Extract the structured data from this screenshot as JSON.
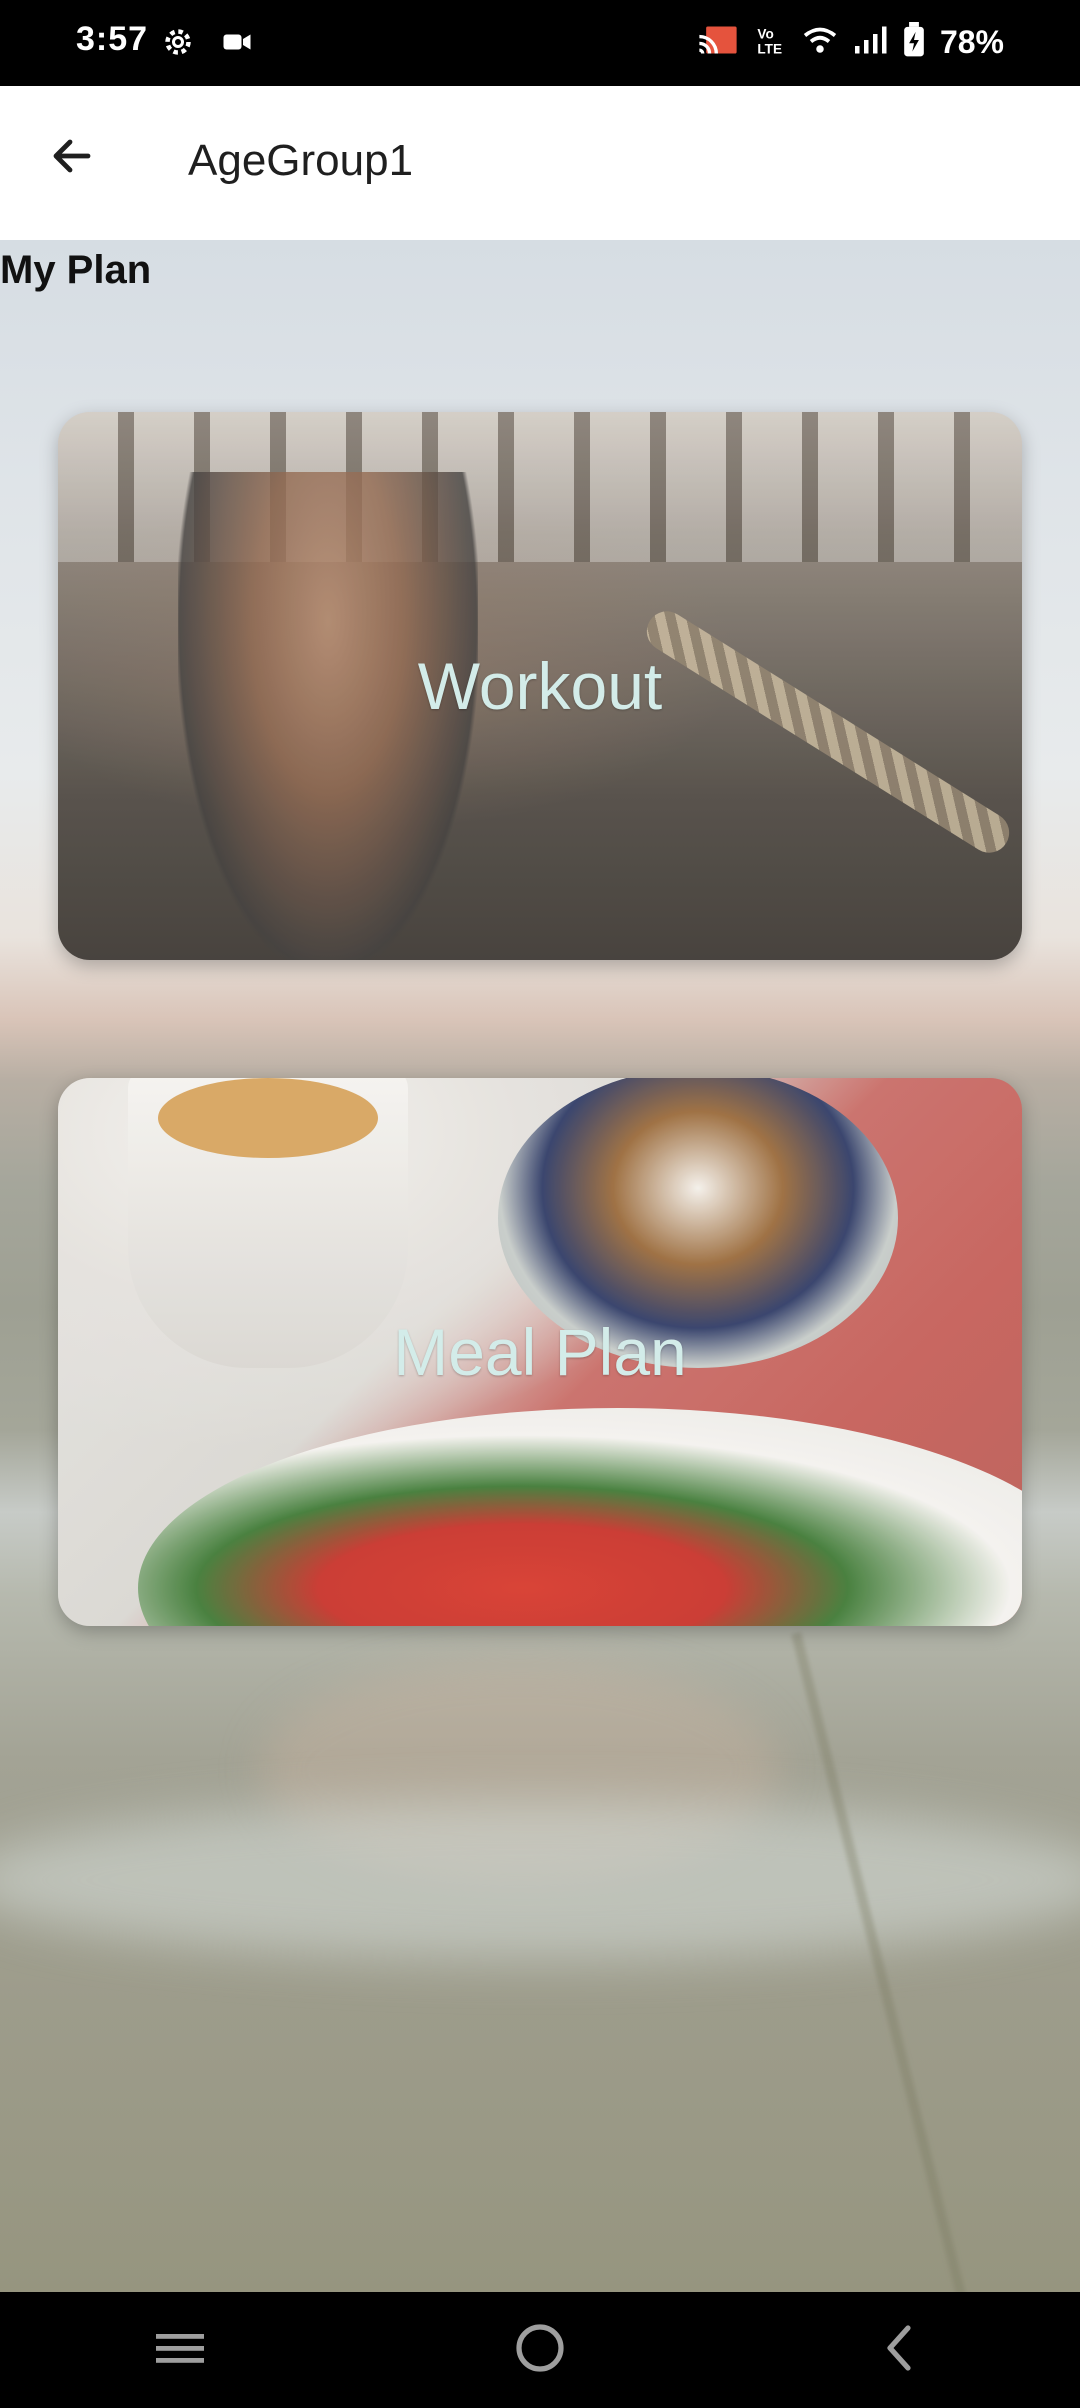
{
  "status_bar": {
    "time": "3:57",
    "battery_percent": "78%",
    "icons": [
      "settings-icon",
      "video-icon",
      "cast-icon",
      "volte-icon",
      "wifi-icon",
      "signal-icon",
      "battery-icon"
    ]
  },
  "app_bar": {
    "title": "AgeGroup1",
    "back_icon": "arrow-left-icon"
  },
  "content": {
    "heading": "My Plan",
    "cards": [
      {
        "label": "Workout",
        "image": "workout-battle-ropes-photo"
      },
      {
        "label": "Meal Plan",
        "image": "breakfast-meal-photo"
      }
    ]
  },
  "nav_bar": {
    "icons": [
      "menu-icon",
      "home-icon",
      "back-icon"
    ]
  },
  "colors": {
    "status_bar_bg": "#000000",
    "app_bar_bg": "#ffffff",
    "card_label_text": "#d3ece9",
    "heading_text": "#111111"
  }
}
